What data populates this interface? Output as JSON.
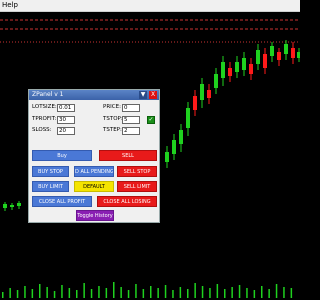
{
  "menubar": {
    "help_label": "Help"
  },
  "panel": {
    "title": "ZPanel v 1",
    "minimize_glyph": "▼",
    "close_glyph": "X",
    "fields": {
      "lotsize_label": "LOTSIZE:",
      "lotsize_value": "0.01",
      "tprofit_label": "TPROFIT:",
      "tprofit_value": "30",
      "sloss_label": "SLOSS:",
      "sloss_value": "20",
      "price_label": "PRICE:",
      "price_value": "0",
      "tstop_label": "TSTOP:",
      "tstop_value": "5",
      "tstep_label": "TSTEP:",
      "tstep_value": "2"
    },
    "checkbox_glyph": "✓",
    "buttons": {
      "buy": "Buy",
      "sell": "SELL",
      "buy_stop": "BUY STOP",
      "del_all_pending": "D ALL PENDING",
      "sell_stop": "SELL STOP",
      "buy_limit": "BUY LIMIT",
      "default": "DEFAULT",
      "sell_limit": "SELL LIMIT",
      "close_all_profit": "CLOSE ALL PROFIT",
      "close_all_losing": "CLOSE ALL LOSING",
      "toggle_history": "Toggle History"
    }
  },
  "colors": {
    "bull_candle": "#1fd21f",
    "bear_candle": "#ff1a1a",
    "level_line": "#c83232",
    "volume": "#1fd21f"
  }
}
